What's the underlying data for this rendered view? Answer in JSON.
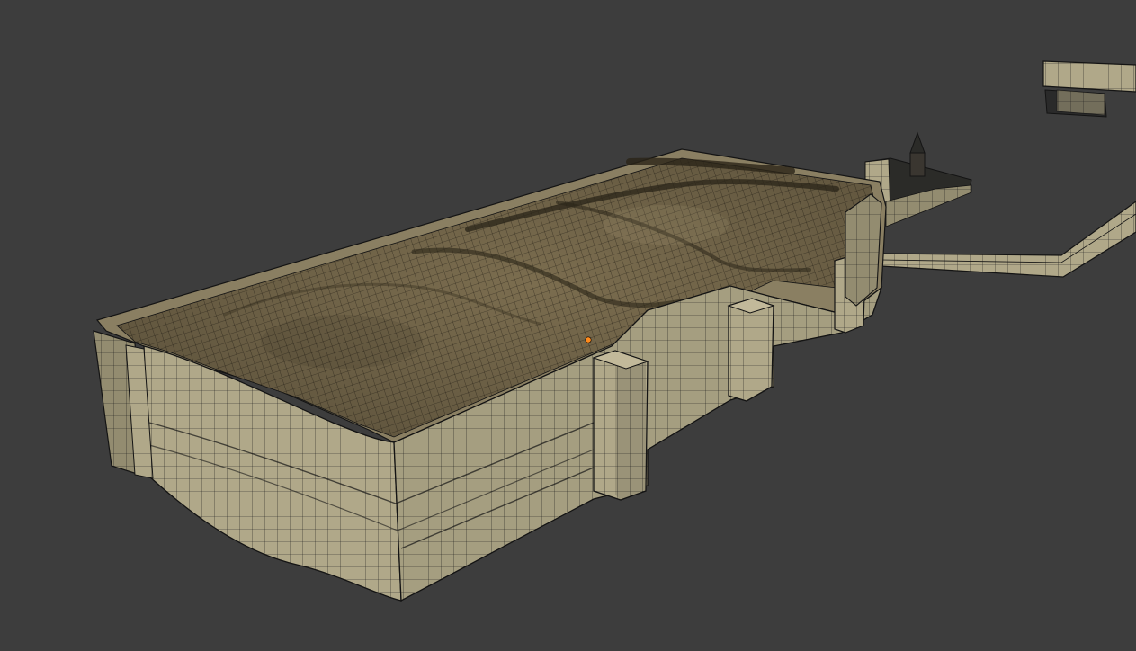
{
  "viewport": {
    "background_color": "#3d3d3d",
    "wire_color": "#141414",
    "wall_color": "#b2aa8c",
    "wall_shadow_color": "#8a8369",
    "terrain_color": "#7d6f50",
    "terrain_dark_color": "#4a4030",
    "origin_marker_color": "#ff8a1c"
  },
  "scene": {
    "objects": [
      {
        "name": "retaining-wall-block"
      },
      {
        "name": "terrain-mesh"
      },
      {
        "name": "wall-pillar"
      },
      {
        "name": "gate-structure"
      },
      {
        "name": "wall-segment-right"
      },
      {
        "name": "wall-segment-far"
      }
    ]
  }
}
